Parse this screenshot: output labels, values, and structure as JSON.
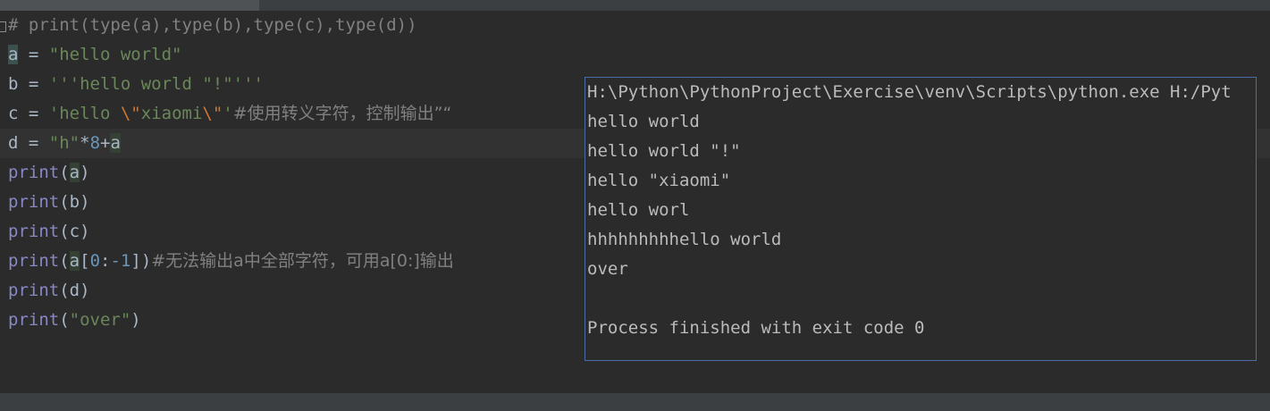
{
  "editor": {
    "line1": {
      "prefix": "# print(type(a),type(b),type(c),type(d))"
    },
    "line2": {
      "var": "a",
      "op": " = ",
      "str": "\"hello world\""
    },
    "line3": {
      "var": "b",
      "op": " = ",
      "str": "'''hello world \"!\"'''"
    },
    "line4": {
      "var": "c",
      "op": " = ",
      "str_a": "'hello ",
      "esc_a": "\\\"",
      "str_b": "xiaomi",
      "esc_b": "\\\"",
      "str_c": "'",
      "comment": "#使用转义字符，控制输出”“"
    },
    "line5": {
      "var": "d",
      "op": " = ",
      "str": "\"h\"",
      "mul": "*",
      "num": "8",
      "plus": "+",
      "a": "a"
    },
    "line6": {
      "fn": "print",
      "open": "(",
      "arg": "a",
      "close": ")"
    },
    "line7": {
      "fn": "print",
      "args": "(b)"
    },
    "line8": {
      "fn": "print",
      "args": "(c)"
    },
    "line9": {
      "fn": "print",
      "open": "(",
      "arg": "a",
      "idx_open": "[",
      "n0": "0",
      "colon": ":",
      "n1": "-1",
      "idx_close": "]",
      "close": ")",
      "comment": "#无法输出a中全部字符，可用a[0:]输出"
    },
    "line10": {
      "fn": "print",
      "args": "(d)"
    },
    "line11": {
      "fn": "print",
      "open": "(",
      "str": "\"over\"",
      "close": ")"
    }
  },
  "console": {
    "lines": [
      "H:\\Python\\PythonProject\\Exercise\\venv\\Scripts\\python.exe H:/Pyt",
      "hello world",
      "hello world \"!\"",
      "hello \"xiaomi\"",
      "hello worl",
      "hhhhhhhhhello world",
      "over",
      "",
      "Process finished with exit code 0"
    ]
  },
  "colors": {
    "background": "#2b2b2b",
    "text": "#a9b7c6",
    "string": "#6a8759",
    "comment": "#808080",
    "escape": "#cc7832",
    "number": "#6897bb",
    "builtin": "#8888c6",
    "console_border": "#4a6da7"
  }
}
